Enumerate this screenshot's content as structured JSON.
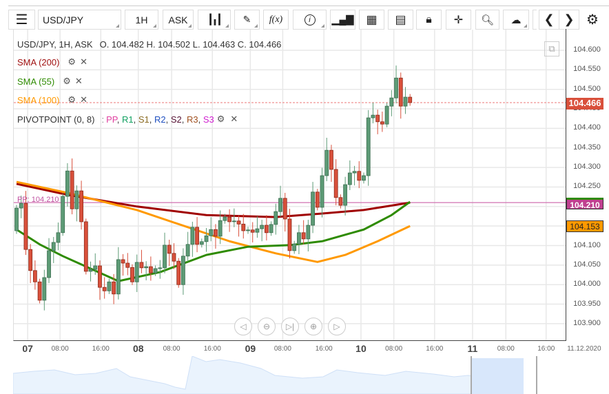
{
  "toolbar": {
    "symbol": "USD/JPY",
    "timeframe": "1H",
    "price_side": "ASK",
    "buttons": [
      "menu-icon",
      "chart-type-icon",
      "draw-icon",
      "function-icon",
      "info-icon",
      "bar-chart-icon",
      "calendar-icon",
      "news-icon",
      "lock-icon",
      "crosshair-icon",
      "zoom-icon",
      "cloud-upload-icon",
      "prev-icon",
      "next-icon",
      "gear-icon"
    ],
    "function_label": "f(x)"
  },
  "header": {
    "title": "USD/JPY, 1H, ASK",
    "ohlc": "O. 104.482 H. 104.502 L. 104.463 C. 104.466"
  },
  "indicators": [
    {
      "label": "SMA (200)",
      "color": "#a01010"
    },
    {
      "label": "SMA (55)",
      "color": "#2e8b00"
    },
    {
      "label": "SMA (100)",
      "color": "#ff9900"
    }
  ],
  "pivot": {
    "label": "PIVOTPOINT (0, 8)",
    "sep": ":",
    "items": [
      {
        "t": "PP",
        "c": "#e040a0"
      },
      {
        "t": "R1",
        "c": "#10a060"
      },
      {
        "t": "S1",
        "c": "#8a6a20"
      },
      {
        "t": "R2",
        "c": "#2050c0"
      },
      {
        "t": "S2",
        "c": "#551133"
      },
      {
        "t": "R3",
        "c": "#a05020"
      },
      {
        "t": "S3",
        "c": "#d020d0"
      }
    ],
    "pp_line_label": "PP: 104.210"
  },
  "price_tags": {
    "last": "104.466",
    "pp": "104.210",
    "sma100": "104.153"
  },
  "colors": {
    "up": "#5d9b76",
    "down": "#d9503b",
    "sma200": "#a00000",
    "sma100": "#ff9900",
    "sma55": "#2e8b00",
    "pp": "#d070b0"
  },
  "chart_data": {
    "type": "candlestick",
    "ylim": [
      103.85,
      104.655
    ],
    "yticks": [
      "104.600",
      "104.550",
      "104.500",
      "104.450",
      "104.400",
      "104.350",
      "104.300",
      "104.250",
      "104.200",
      "104.150",
      "104.100",
      "104.050",
      "104.000",
      "103.950",
      "103.900"
    ],
    "xticks": [
      {
        "t": "07",
        "big": true,
        "i": 2.4
      },
      {
        "t": "08:00",
        "i": 9.4
      },
      {
        "t": "16:00",
        "i": 18.2
      },
      {
        "t": "08",
        "big": true,
        "i": 26.3
      },
      {
        "t": "08:00",
        "i": 33.5
      },
      {
        "t": "16:00",
        "i": 42.3
      },
      {
        "t": "09",
        "big": true,
        "i": 50.5
      },
      {
        "t": "08:00",
        "i": 57.5
      },
      {
        "t": "16:00",
        "i": 66.4
      },
      {
        "t": "10",
        "big": true,
        "i": 74.4
      },
      {
        "t": "08:00",
        "i": 81.5
      },
      {
        "t": "16:00",
        "i": 90.3
      },
      {
        "t": "11",
        "big": true,
        "i": 98.5
      },
      {
        "t": "08:00",
        "i": 105.7
      },
      {
        "t": "16:00",
        "i": 114.4
      },
      {
        "t": "11.12.2020",
        "i": 122.6
      }
    ],
    "first_open": 104.138,
    "closes": [
      104.196,
      104.208,
      104.09,
      104.036,
      104.007,
      103.96,
      104.018,
      104.087,
      104.108,
      104.133,
      104.226,
      104.291,
      104.194,
      104.24,
      104.161,
      104.034,
      104.039,
      104.048,
      103.993,
      103.984,
      104.007,
      103.976,
      104.064,
      104.055,
      104.044,
      104.007,
      104.057,
      104.043,
      104.046,
      104.03,
      104.041,
      104.043,
      104.101,
      104.08,
      104.06,
      104.0,
      104.073,
      104.103,
      104.147,
      104.103,
      104.11,
      104.125,
      104.141,
      104.124,
      104.164,
      104.173,
      104.161,
      104.163,
      104.155,
      104.138,
      104.14,
      104.134,
      104.143,
      104.152,
      104.133,
      104.154,
      104.187,
      104.221,
      104.168,
      104.087,
      104.104,
      104.133,
      104.117,
      104.152,
      104.237,
      104.198,
      104.279,
      104.344,
      104.295,
      104.223,
      104.203,
      104.256,
      104.286,
      104.29,
      104.267,
      104.279,
      104.427,
      104.434,
      104.417,
      104.411,
      104.457,
      104.478,
      104.529,
      104.457,
      104.48,
      104.466
    ],
    "sma200": [
      [
        0,
        104.258
      ],
      [
        11,
        104.23
      ],
      [
        26,
        104.2
      ],
      [
        41,
        104.178
      ],
      [
        56,
        104.173
      ],
      [
        66,
        104.182
      ],
      [
        75,
        104.191
      ],
      [
        85,
        104.21
      ]
    ],
    "sma100": [
      [
        0,
        104.263
      ],
      [
        11,
        104.235
      ],
      [
        26,
        104.191
      ],
      [
        37,
        104.147
      ],
      [
        46,
        104.111
      ],
      [
        56,
        104.08
      ],
      [
        65,
        104.058
      ],
      [
        71,
        104.076
      ],
      [
        78,
        104.111
      ],
      [
        85,
        104.15
      ]
    ],
    "sma55": [
      [
        0,
        104.141
      ],
      [
        5,
        104.103
      ],
      [
        10,
        104.073
      ],
      [
        16,
        104.041
      ],
      [
        22,
        104.009
      ],
      [
        31,
        104.032
      ],
      [
        41,
        104.076
      ],
      [
        50,
        104.097
      ],
      [
        59,
        104.101
      ],
      [
        66,
        104.111
      ],
      [
        75,
        104.141
      ],
      [
        81,
        104.178
      ],
      [
        85,
        104.212
      ]
    ],
    "pp": 104.21
  }
}
